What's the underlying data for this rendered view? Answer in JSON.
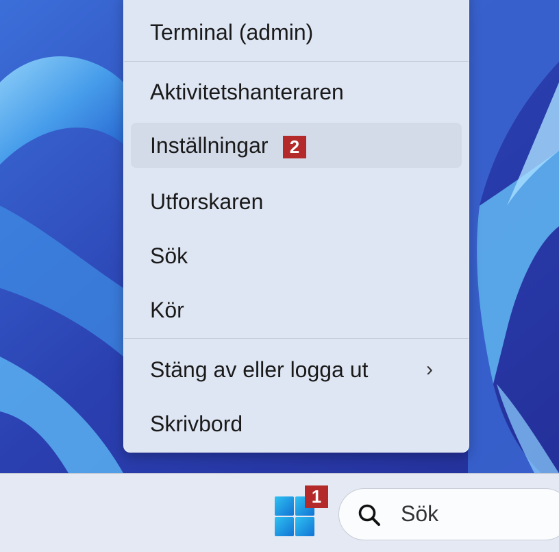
{
  "menu": {
    "items": [
      {
        "label": "Terminal (admin)"
      },
      {
        "label": "Aktivitetshanteraren"
      },
      {
        "label": "Inställningar"
      },
      {
        "label": "Utforskaren"
      },
      {
        "label": "Sök"
      },
      {
        "label": "Kör"
      },
      {
        "label": "Stäng av eller logga ut"
      },
      {
        "label": "Skrivbord"
      }
    ],
    "submenu_chevron": "›"
  },
  "callouts": {
    "settings_badge": "2",
    "start_badge": "1"
  },
  "taskbar": {
    "search_text": "Sök",
    "start_icon": "windows-logo-icon",
    "search_icon": "search-icon"
  },
  "colors": {
    "badge": "#b42a2a",
    "wallpaper": "#2b3aa6",
    "menu_bg": "#dfe6f3"
  }
}
